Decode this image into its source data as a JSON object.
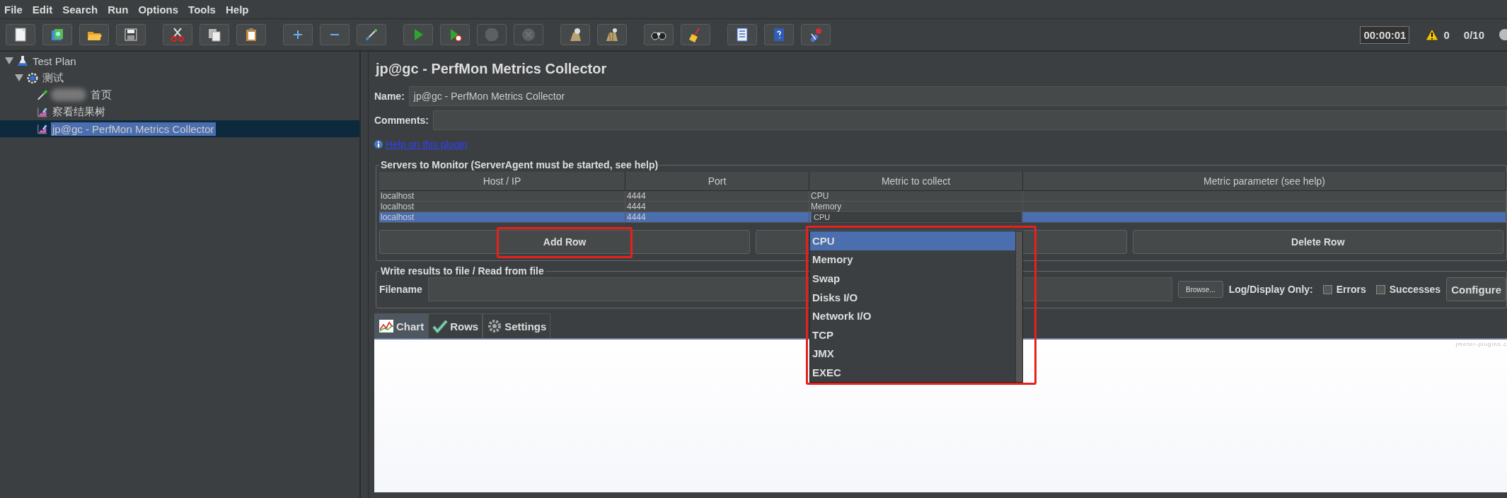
{
  "menu": [
    "File",
    "Edit",
    "Search",
    "Run",
    "Options",
    "Tools",
    "Help"
  ],
  "toolbar": [
    [
      {
        "kind": "new",
        "disabled": false
      },
      {
        "kind": "templates",
        "disabled": false
      },
      {
        "kind": "open",
        "disabled": false
      },
      {
        "kind": "save",
        "disabled": false
      }
    ],
    [
      {
        "kind": "cut",
        "disabled": false
      },
      {
        "kind": "copy",
        "disabled": false
      },
      {
        "kind": "paste",
        "disabled": false
      }
    ],
    [
      {
        "kind": "expand",
        "disabled": false
      },
      {
        "kind": "collapse",
        "disabled": false
      },
      {
        "kind": "toggle",
        "disabled": false
      }
    ],
    [
      {
        "kind": "start",
        "disabled": false
      },
      {
        "kind": "start-no-timers",
        "disabled": false
      },
      {
        "kind": "stop",
        "disabled": true
      },
      {
        "kind": "shutdown",
        "disabled": true
      }
    ],
    [
      {
        "kind": "clear",
        "disabled": false
      },
      {
        "kind": "clear-all",
        "disabled": false
      }
    ],
    [
      {
        "kind": "search",
        "disabled": false
      },
      {
        "kind": "reset",
        "disabled": false
      }
    ],
    [
      {
        "kind": "functions",
        "disabled": false
      },
      {
        "kind": "help",
        "disabled": false
      },
      {
        "kind": "remote",
        "disabled": false
      }
    ]
  ],
  "status": {
    "timer": "00:00:01",
    "warnings": "0",
    "threads": "0/10"
  },
  "tree": [
    {
      "label": "Test Plan",
      "kind": "plan",
      "expanded": true,
      "selected": false,
      "children": [
        {
          "label": "测试",
          "kind": "thread-group",
          "expanded": true,
          "selected": false,
          "children": [
            {
              "label": "首页",
              "kind": "sampler",
              "redacted": true,
              "selected": false
            },
            {
              "label": "察看结果树",
              "kind": "listener",
              "selected": false
            },
            {
              "label": "jp@gc - PerfMon Metrics Collector",
              "kind": "listener",
              "selected": true
            }
          ]
        }
      ]
    }
  ],
  "panel": {
    "title": "jp@gc - PerfMon Metrics Collector",
    "name_label": "Name:",
    "name_value": "jp@gc - PerfMon Metrics Collector",
    "comments_label": "Comments:",
    "help_link": "Help on this plugin"
  },
  "servers": {
    "legend": "Servers to Monitor (ServerAgent must be started, see help)",
    "columns": [
      "Host / IP",
      "Port",
      "Metric to collect",
      "Metric parameter (see help)"
    ],
    "rows": [
      {
        "cells": [
          "localhost",
          "4444",
          "CPU"
        ],
        "selected": false,
        "editing": false
      },
      {
        "cells": [
          "localhost",
          "4444",
          "Memory"
        ],
        "selected": false,
        "editing": false
      },
      {
        "cells": [
          "localhost",
          "4444",
          "CPU"
        ],
        "selected": true,
        "editing": true
      }
    ],
    "buttons": [
      {
        "label": "Add Row",
        "annotated": true
      },
      {
        "covered": true
      },
      {
        "label": "Delete Row",
        "annotated": false
      }
    ],
    "dropdown": {
      "annotated": true,
      "options": [
        {
          "label": "CPU",
          "selected": true
        },
        {
          "label": "Memory",
          "selected": false
        },
        {
          "label": "Swap",
          "selected": false
        },
        {
          "label": "Disks I/O",
          "selected": false
        },
        {
          "label": "Network I/O",
          "selected": false
        },
        {
          "label": "TCP",
          "selected": false
        },
        {
          "label": "JMX",
          "selected": false
        },
        {
          "label": "EXEC",
          "selected": false
        }
      ]
    }
  },
  "write": {
    "legend": "Write results to file / Read from file",
    "filename_label": "Filename",
    "browse": "Browse...",
    "log_label": "Log/Display Only:",
    "checks": [
      {
        "label": "Errors",
        "checked": false
      },
      {
        "label": "Successes",
        "checked": false
      }
    ],
    "configure": "Configure"
  },
  "tabs": [
    {
      "label": "Chart",
      "kind": "chart",
      "selected": true
    },
    {
      "label": "Rows",
      "kind": "rows",
      "selected": false
    },
    {
      "label": "Settings",
      "kind": "settings",
      "selected": false
    }
  ],
  "chart": {
    "credit": "jmeter-plugins.c"
  }
}
